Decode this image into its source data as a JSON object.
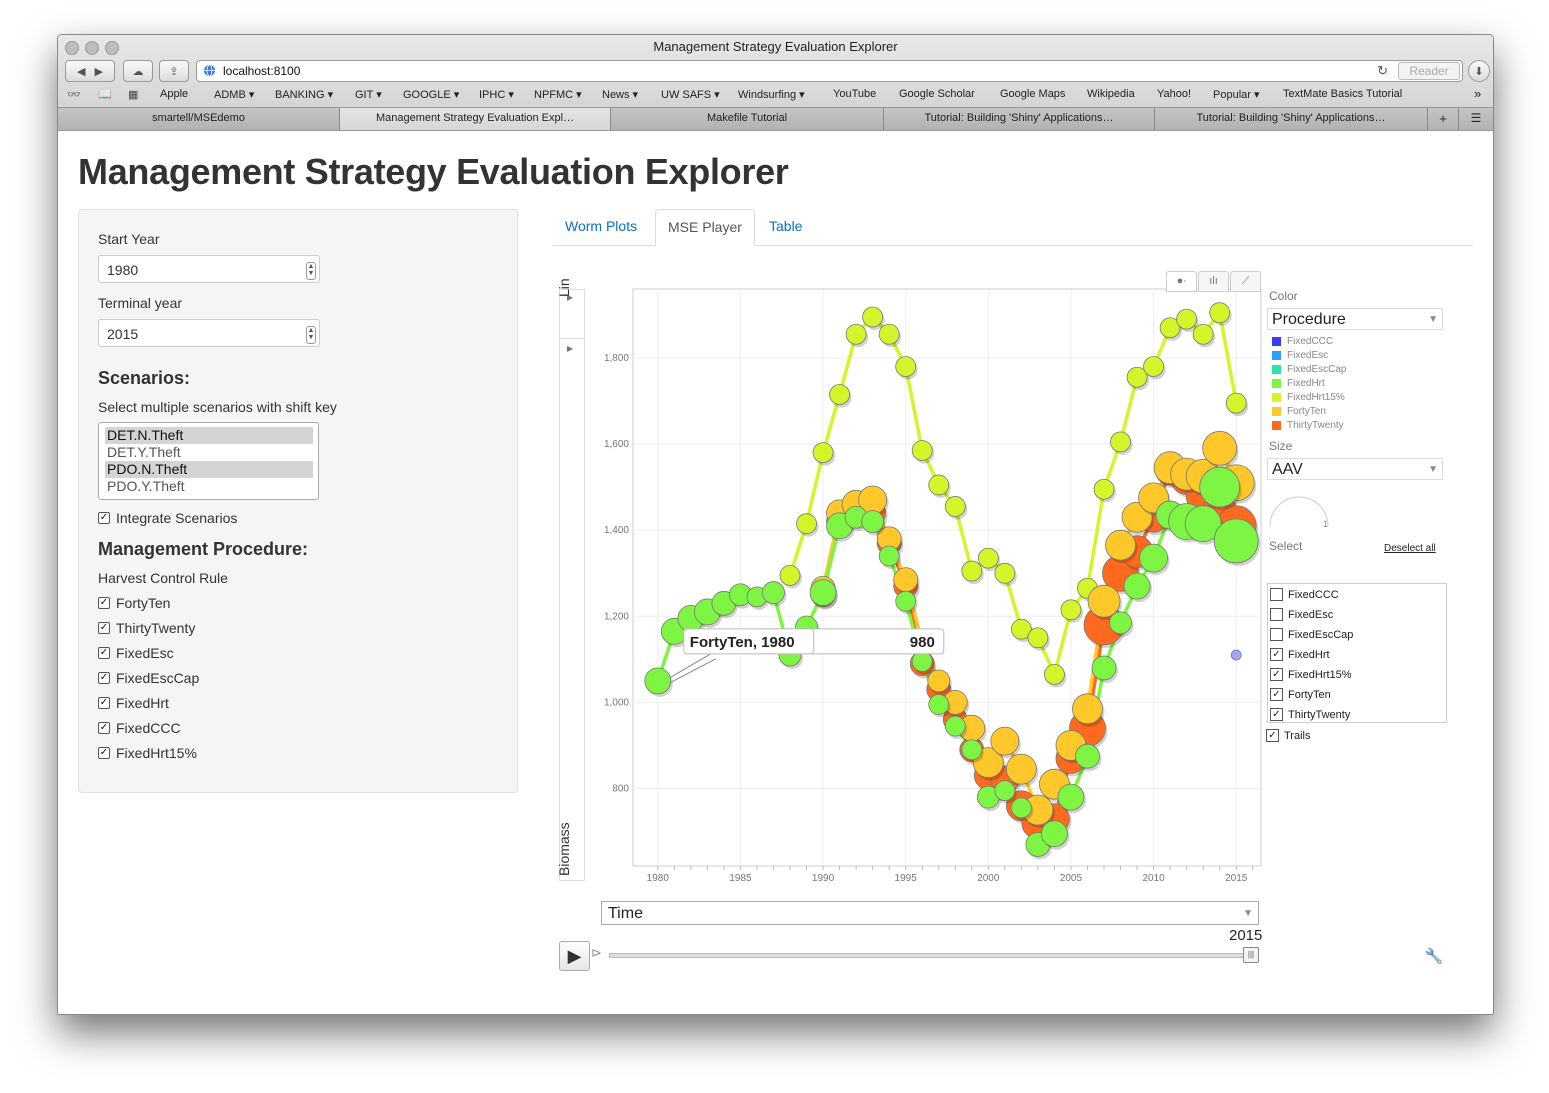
{
  "window": {
    "title": "Management Strategy Evaluation Explorer"
  },
  "browser": {
    "url": "localhost:8100",
    "reader_label": "Reader",
    "bookmarks": [
      "Apple",
      "ADMB ▾",
      "BANKING ▾",
      "GIT ▾",
      "GOOGLE ▾",
      "IPHC ▾",
      "NPFMC ▾",
      "News ▾",
      "UW SAFS ▾",
      "Windsurfing ▾",
      "YouTube",
      "Google Scholar",
      "Google Maps",
      "Wikipedia",
      "Yahoo!",
      "Popular ▾",
      "TextMate Basics Tutorial"
    ],
    "tabs": [
      "smartell/MSEdemo",
      "Management Strategy Evaluation Expl…",
      "Makefile Tutorial",
      "Tutorial: Building 'Shiny' Applications…",
      "Tutorial: Building 'Shiny' Applications…"
    ],
    "active_tab": 1
  },
  "page": {
    "title": "Management Strategy Evaluation Explorer"
  },
  "sidebar": {
    "start_year_label": "Start Year",
    "start_year_value": "1980",
    "terminal_year_label": "Terminal year",
    "terminal_year_value": "2015",
    "scenarios_heading": "Scenarios:",
    "scenarios_hint": "Select multiple scenarios with shift key",
    "scenarios": [
      {
        "label": "DET.N.Theft",
        "selected": true
      },
      {
        "label": "DET.Y.Theft",
        "selected": false
      },
      {
        "label": "PDO.N.Theft",
        "selected": true
      },
      {
        "label": "PDO.Y.Theft",
        "selected": false
      }
    ],
    "integrate_label": "Integrate Scenarios",
    "procedure_heading": "Management Procedure:",
    "hcr_label": "Harvest Control Rule",
    "hcr_items": [
      "FortyTen",
      "ThirtyTwenty",
      "FixedEsc",
      "FixedEscCap",
      "FixedHrt",
      "FixedCCC",
      "FixedHrt15%"
    ]
  },
  "tabs": {
    "items": [
      "Worm Plots",
      "MSE Player",
      "Table"
    ],
    "active": 1
  },
  "motion_chart": {
    "y_scale_label": "Lin",
    "y_var": "Biomass",
    "x_var": "Time",
    "color_label": "Color",
    "color_var": "Procedure",
    "size_label": "Size",
    "size_var": "AAV",
    "size_gauge_value": "1",
    "select_label": "Select",
    "deselect_all": "Deselect all",
    "trails_label": "Trails",
    "current_year": "2015",
    "tooltip": "FortyTen, 1980",
    "tooltip_shadow": "980",
    "legend": [
      {
        "name": "FixedCCC",
        "color": "#3b3bf0"
      },
      {
        "name": "FixedEsc",
        "color": "#2f9ef5"
      },
      {
        "name": "FixedEscCap",
        "color": "#2ee0b0"
      },
      {
        "name": "FixedHrt",
        "color": "#7ef542"
      },
      {
        "name": "FixedHrt15%",
        "color": "#d4f52a"
      },
      {
        "name": "FortyTen",
        "color": "#ffc82a"
      },
      {
        "name": "ThirtyTwenty",
        "color": "#ff6a1f"
      }
    ],
    "select_items": [
      {
        "name": "FixedCCC",
        "checked": false
      },
      {
        "name": "FixedEsc",
        "checked": false
      },
      {
        "name": "FixedEscCap",
        "checked": false
      },
      {
        "name": "FixedHrt",
        "checked": true
      },
      {
        "name": "FixedHrt15%",
        "checked": true
      },
      {
        "name": "FortyTen",
        "checked": true
      },
      {
        "name": "ThirtyTwenty",
        "checked": true
      }
    ]
  },
  "chart_data": {
    "type": "scatter",
    "title": "",
    "xlabel": "Time",
    "ylabel": "Biomass",
    "xlim": [
      1978.5,
      2016.5
    ],
    "ylim": [
      620,
      1960
    ],
    "x_ticks": [
      1980,
      1985,
      1990,
      1995,
      2000,
      2005,
      2010,
      2015
    ],
    "y_ticks": [
      800,
      1000,
      1200,
      1400,
      1600,
      1800
    ],
    "y_tick_labels": [
      "800",
      "1,000",
      "1,200",
      "1,400",
      "1,600",
      "1,800"
    ],
    "grid": true,
    "trails": true,
    "series": [
      {
        "name": "FixedHrt15%",
        "color": "#d4f52a",
        "size": 10,
        "x": [
          1988,
          1989,
          1990,
          1991,
          1992,
          1993,
          1994,
          1995,
          1996,
          1997,
          1998,
          1999,
          2000,
          2001,
          2002,
          2003,
          2004,
          2005,
          2006,
          2007,
          2008,
          2009,
          2010,
          2011,
          2012,
          2013,
          2014,
          2015
        ],
        "y": [
          1295,
          1415,
          1580,
          1715,
          1855,
          1895,
          1855,
          1780,
          1585,
          1505,
          1455,
          1305,
          1335,
          1300,
          1170,
          1150,
          1065,
          1215,
          1265,
          1495,
          1605,
          1755,
          1780,
          1870,
          1890,
          1855,
          1905,
          1695
        ]
      },
      {
        "name": "ThirtyTwenty",
        "color": "#ff6a1f",
        "size": 14,
        "x": [
          1990,
          1991,
          1992,
          1993,
          1994,
          1995,
          1996,
          1997,
          1998,
          1999,
          2000,
          2001,
          2002,
          2003,
          2004,
          2005,
          2006,
          2007,
          2008,
          2009,
          2010,
          2011,
          2012,
          2013,
          2014,
          2015
        ],
        "y": [
          1250,
          1420,
          1440,
          1440,
          1370,
          1270,
          1090,
          1030,
          960,
          890,
          830,
          820,
          760,
          720,
          730,
          870,
          940,
          1180,
          1300,
          1350,
          1430,
          1540,
          1520,
          1480,
          1440,
          1410
        ],
        "sizes": [
          12,
          13,
          13,
          13,
          12,
          12,
          12,
          12,
          12,
          12,
          14,
          14,
          15,
          16,
          15,
          15,
          18,
          20,
          18,
          16,
          15,
          15,
          16,
          17,
          18,
          20
        ]
      },
      {
        "name": "FortyTen",
        "color": "#ffc82a",
        "size": 14,
        "x": [
          1990,
          1991,
          1992,
          1993,
          1994,
          1995,
          1996,
          1997,
          1998,
          1999,
          2000,
          2001,
          2002,
          2003,
          2004,
          2005,
          2006,
          2007,
          2008,
          2009,
          2010,
          2011,
          2012,
          2013,
          2014,
          2015
        ],
        "y": [
          1265,
          1440,
          1460,
          1470,
          1380,
          1285,
          1140,
          1050,
          1000,
          940,
          860,
          910,
          845,
          750,
          810,
          900,
          985,
          1235,
          1365,
          1430,
          1475,
          1545,
          1530,
          1525,
          1590,
          1510
        ],
        "sizes": [
          12,
          13,
          14,
          14,
          12,
          12,
          12,
          11,
          12,
          13,
          15,
          14,
          15,
          15,
          15,
          15,
          15,
          16,
          15,
          15,
          15,
          16,
          16,
          17,
          17,
          18
        ]
      },
      {
        "name": "FixedHrt",
        "color": "#7ef542",
        "size": 13,
        "x": [
          1980,
          1981,
          1982,
          1983,
          1984,
          1985,
          1986,
          1987,
          1988,
          1989,
          1990,
          1991,
          1992,
          1993,
          1994,
          1995,
          1996,
          1997,
          1998,
          1999,
          2000,
          2001,
          2002,
          2003,
          2004,
          2005,
          2006,
          2007,
          2008,
          2009,
          2010,
          2011,
          2012,
          2013,
          2014,
          2015
        ],
        "y": [
          1050,
          1165,
          1195,
          1210,
          1230,
          1250,
          1245,
          1255,
          1110,
          1175,
          1255,
          1410,
          1430,
          1420,
          1340,
          1235,
          1095,
          995,
          945,
          890,
          780,
          795,
          755,
          670,
          695,
          780,
          875,
          1080,
          1185,
          1270,
          1335,
          1435,
          1420,
          1415,
          1500,
          1375
        ],
        "sizes": [
          13,
          13,
          13,
          13,
          12,
          11,
          10,
          11,
          11,
          11,
          13,
          13,
          11,
          11,
          10,
          10,
          10,
          10,
          10,
          10,
          11,
          10,
          10,
          12,
          13,
          13,
          12,
          12,
          11,
          13,
          14,
          14,
          18,
          18,
          20,
          22
        ]
      }
    ],
    "extra_points": [
      {
        "name": "FixedCCC",
        "x": 2015,
        "y": 1110
      }
    ]
  }
}
